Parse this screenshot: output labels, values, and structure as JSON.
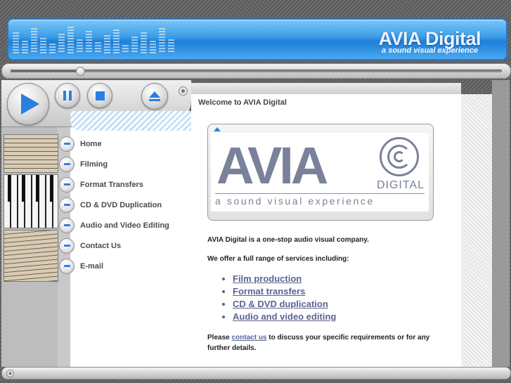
{
  "header": {
    "brand": "AVIA Digital",
    "tagline": "a sound visual experience"
  },
  "player": {
    "seek_progress_pct": 14,
    "play_icon": "play-icon",
    "pause_icon": "pause-icon",
    "stop_icon": "stop-icon",
    "eject_icon": "eject-icon",
    "accent_color": "#2b7fe0"
  },
  "nav": {
    "items": [
      {
        "label": "Home"
      },
      {
        "label": "Filming"
      },
      {
        "label": "Format Transfers"
      },
      {
        "label": "CD & DVD Duplication"
      },
      {
        "label": "Audio and Video Editing"
      },
      {
        "label": "Contact Us"
      },
      {
        "label": "E-mail"
      }
    ]
  },
  "content": {
    "welcome": "Welcome to AVIA Digital",
    "logo": {
      "word": "AVIA",
      "digital": "DIGITAL",
      "subtitle": "a sound visual experience"
    },
    "intro": "AVIA Digital is a one-stop audio visual company.",
    "offer": "We offer a full range of services including:",
    "services": [
      "Film production",
      "Format transfers",
      "CD & DVD duplication",
      "Audio and video editing"
    ],
    "contact_prefix": "Please ",
    "contact_link": "contact us",
    "contact_suffix": " to discuss your specific requirements or for any further details."
  }
}
